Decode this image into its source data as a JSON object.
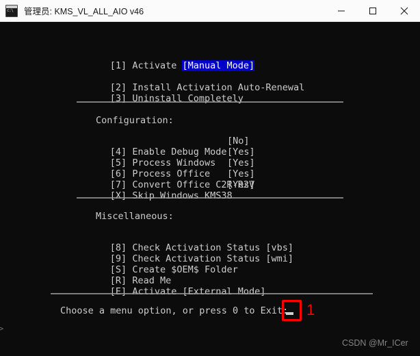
{
  "window": {
    "title": "管理员: KMS_VL_ALL_AIO v46",
    "icon": "console-icon",
    "controls": {
      "minimize": "minimize-icon",
      "maximize": "maximize-icon",
      "close": "close-icon"
    }
  },
  "console": {
    "primary": [
      {
        "key": "[1]",
        "label": "Activate",
        "value": "[Manual Mode]",
        "highlight": true
      }
    ],
    "actions": [
      {
        "key": "[2]",
        "label": "Install Activation Auto-Renewal"
      },
      {
        "key": "[3]",
        "label": "Uninstall Completely"
      }
    ],
    "configuration": {
      "heading": "Configuration:",
      "items": [
        {
          "key": "[4]",
          "label": "Enable Debug Mode",
          "value": "[No]"
        },
        {
          "key": "[5]",
          "label": "Process Windows",
          "value": "[Yes]"
        },
        {
          "key": "[6]",
          "label": "Process Office",
          "value": "[Yes]"
        },
        {
          "key": "[7]",
          "label": "Convert Office C2R-R2V",
          "value": "[Yes]"
        },
        {
          "key": "[X]",
          "label": "Skip Windows KMS38",
          "value": "[Yes]"
        }
      ]
    },
    "miscellaneous": {
      "heading": "Miscellaneous:",
      "items": [
        {
          "key": "[8]",
          "label": "Check Activation Status [vbs]"
        },
        {
          "key": "[9]",
          "label": "Check Activation Status [wmi]"
        },
        {
          "key": "[S]",
          "label": "Create $OEM$ Folder"
        },
        {
          "key": "[R]",
          "label": "Read Me"
        },
        {
          "key": "[E]",
          "label": "Activate [External Mode]"
        }
      ]
    },
    "prompt": {
      "text": "Choose a menu option, or press 0 to Exit:",
      "cursor": "_",
      "edge_arrow": ">"
    }
  },
  "annotation": {
    "number": "1",
    "color": "#fe0000"
  },
  "watermark": "CSDN @Mr_ICer"
}
